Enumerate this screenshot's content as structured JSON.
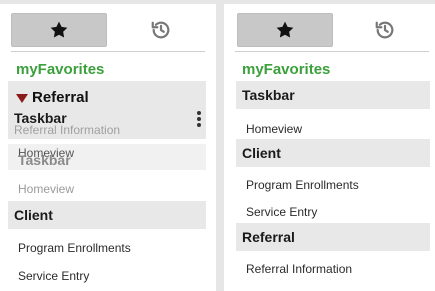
{
  "left": {
    "favorites_tab_icon": "star-icon",
    "history_tab_icon": "history-icon",
    "title": "myFavorites",
    "drag": {
      "label": "Referral",
      "arrow_icon": "drag-arrow-down-icon",
      "ghost_section": "Taskbar",
      "ghost_item": "Referral Information",
      "menu_icon": "kebab-menu-icon",
      "ghost_section_overlap": "Taskbar",
      "ghost_item_overlap": "Homeview"
    },
    "sections": [
      {
        "label": "Homeview",
        "faded": true
      },
      {
        "label": "Client",
        "items": [
          "Program Enrollments",
          "Service Entry"
        ]
      }
    ]
  },
  "right": {
    "favorites_tab_icon": "star-icon",
    "history_tab_icon": "history-icon",
    "title": "myFavorites",
    "sections": [
      {
        "label": "Taskbar",
        "items": [
          "Homeview"
        ]
      },
      {
        "label": "Client",
        "items": [
          "Program Enrollments",
          "Service Entry"
        ]
      },
      {
        "label": "Referral",
        "items": [
          "Referral Information"
        ]
      }
    ]
  },
  "colors": {
    "accent_green": "#3ca03c",
    "drag_arrow": "#8b1a1a",
    "section_bg": "#e8e8e8",
    "tab_active_bg": "#c8c8c8"
  }
}
